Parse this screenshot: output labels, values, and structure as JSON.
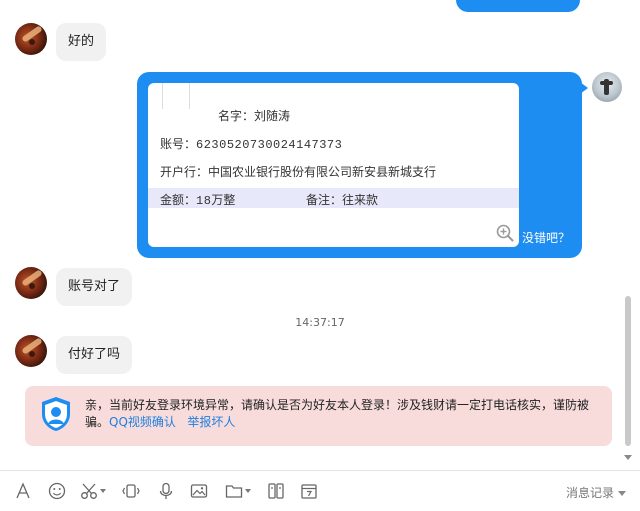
{
  "messages": {
    "msg1": "好的",
    "msg2": "账号对了",
    "msg3": "付好了吗",
    "timestamp": "14:37:17"
  },
  "image_card": {
    "name_line": "名字：刘随涛",
    "account_label": "账号：",
    "account_number": "6230520730024147373",
    "bank_line": "开户行：中国农业银行股份有限公司新安县新城支行",
    "amount_label": "金额：",
    "amount_value": "18",
    "amount_unit": "万整",
    "remark_line": "备注：往来款"
  },
  "outgoing_caption": "没错吧？",
  "warning": {
    "text": "亲，当前好友登录环境异常，请确认是否为好友本人登录！涉及钱财请一定打电话核实，谨防被骗。",
    "video_link": "QQ视频确认",
    "report_link": "举报坏人"
  },
  "toolbar": {
    "history_label": "消息记录",
    "icons": [
      "font-icon",
      "emoji-icon",
      "scissors-icon",
      "screenshot-icon",
      "mic-icon",
      "image-icon",
      "folder-icon",
      "camera-icon",
      "calendar-icon"
    ]
  },
  "colors": {
    "outgoing_bubble": "#1e8df2",
    "incoming_bubble": "#f1f1f1",
    "warning_bg": "#f8dcdc",
    "link": "#1e7fe0"
  }
}
